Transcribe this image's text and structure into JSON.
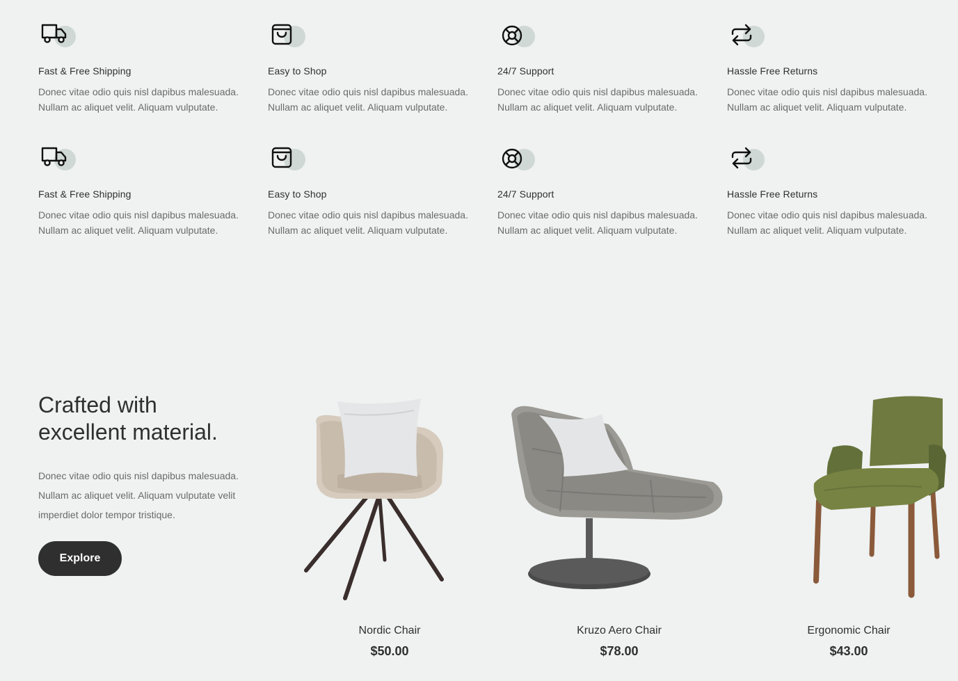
{
  "features": [
    {
      "icon": "truck-icon",
      "title": "Fast & Free Shipping",
      "text": "Donec vitae odio quis nisl dapibus malesuada. Nullam ac aliquet velit. Aliquam vulputate."
    },
    {
      "icon": "bag-icon",
      "title": "Easy to Shop",
      "text": "Donec vitae odio quis nisl dapibus malesuada. Nullam ac aliquet velit. Aliquam vulputate."
    },
    {
      "icon": "support-icon",
      "title": "24/7 Support",
      "text": "Donec vitae odio quis nisl dapibus malesuada. Nullam ac aliquet velit. Aliquam vulputate."
    },
    {
      "icon": "returns-icon",
      "title": "Hassle Free Returns",
      "text": "Donec vitae odio quis nisl dapibus malesuada. Nullam ac aliquet velit. Aliquam vulputate."
    },
    {
      "icon": "truck-icon",
      "title": "Fast & Free Shipping",
      "text": "Donec vitae odio quis nisl dapibus malesuada. Nullam ac aliquet velit. Aliquam vulputate."
    },
    {
      "icon": "bag-icon",
      "title": "Easy to Shop",
      "text": "Donec vitae odio quis nisl dapibus malesuada. Nullam ac aliquet velit. Aliquam vulputate."
    },
    {
      "icon": "support-icon",
      "title": "24/7 Support",
      "text": "Donec vitae odio quis nisl dapibus malesuada. Nullam ac aliquet velit. Aliquam vulputate."
    },
    {
      "icon": "returns-icon",
      "title": "Hassle Free Returns",
      "text": "Donec vitae odio quis nisl dapibus malesuada. Nullam ac aliquet velit. Aliquam vulputate."
    }
  ],
  "crafted": {
    "title_line1": "Crafted with",
    "title_line2": "excellent material.",
    "text": "Donec vitae odio quis nisl dapibus malesuada. Nullam ac aliquet velit. Aliquam vulputate velit imperdiet dolor tempor tristique.",
    "button_label": "Explore"
  },
  "products": [
    {
      "name": "Nordic Chair",
      "price": "$50.00",
      "image": "nordic-chair"
    },
    {
      "name": "Kruzo Aero Chair",
      "price": "$78.00",
      "image": "kruzo-aero-chair"
    },
    {
      "name": "Ergonomic Chair",
      "price": "$43.00",
      "image": "ergonomic-chair"
    }
  ],
  "colors": {
    "background": "#eff2f1",
    "icon_circle": "#cfd8d4",
    "button": "#2f2f2f",
    "text_dark": "#2f2f2f",
    "text_muted": "#6a6a6a"
  }
}
